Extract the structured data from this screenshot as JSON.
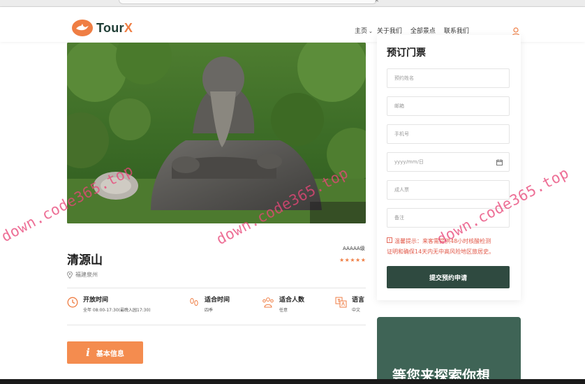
{
  "brand": {
    "name_part1": "Tour",
    "name_part2": "X",
    "accent": "#ef7e44",
    "dark": "#1f3d35"
  },
  "nav": {
    "items": [
      {
        "label": "主页"
      },
      {
        "label": "关于我们"
      },
      {
        "label": "全部景点"
      },
      {
        "label": "联系我们"
      }
    ],
    "caret": "⌄",
    "user_icon": "user-icon"
  },
  "attraction": {
    "title": "清源山",
    "location": "福建泉州",
    "grade": "AAAAA级",
    "stars": "★★★★★",
    "rating": 5,
    "info": [
      {
        "label": "开放时间",
        "value": "全年 08:00-17:30(最晚入园17:30)",
        "icon": "clock-icon"
      },
      {
        "label": "适合时间",
        "value": "四季",
        "icon": "footprints-icon"
      },
      {
        "label": "适合人数",
        "value": "任意",
        "icon": "group-icon"
      },
      {
        "label": "语言",
        "value": "中文",
        "icon": "translate-icon"
      }
    ],
    "basic_info_button": {
      "icon": "i",
      "label": "基本信息"
    }
  },
  "booking": {
    "title": "预订门票",
    "fields": [
      {
        "placeholder": "预约姓名"
      },
      {
        "placeholder": "邮箱"
      },
      {
        "placeholder": "手机号"
      },
      {
        "placeholder": "yyyy/mm/日",
        "icon": "calendar-icon"
      },
      {
        "placeholder": "成人票"
      },
      {
        "placeholder": "备注"
      }
    ],
    "notice_line1": "温馨提示：来客需提供48小时核酸检测",
    "notice_line2": "证明和确保14天内无中高风险地区旅居史。",
    "submit_label": "提交预约申请",
    "button_color": "#2f4a40"
  },
  "promo": {
    "text": "等您来探索你想"
  },
  "watermark": {
    "text": "down.code365.top"
  }
}
